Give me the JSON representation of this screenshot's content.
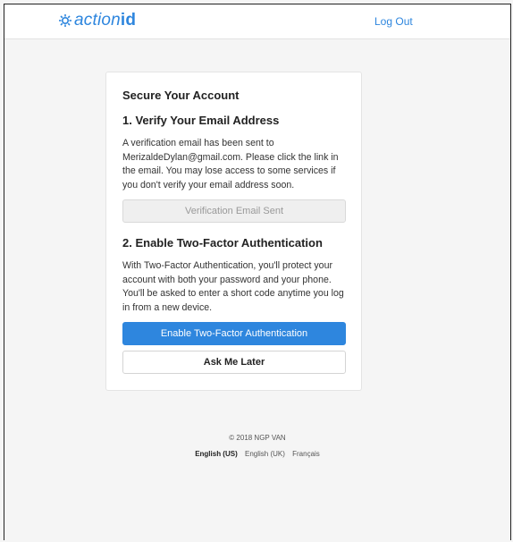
{
  "header": {
    "logo_part1": "action",
    "logo_part2": "id",
    "logout_label": "Log Out"
  },
  "card": {
    "title": "Secure Your Account",
    "section1": {
      "title": "1. Verify Your Email Address",
      "text": "A verification email has been sent to MerizaldeDylan@gmail.com. Please click the link in the email. You may lose access to some services if you don't verify your email address soon.",
      "button_label": "Verification Email Sent"
    },
    "section2": {
      "title": "2. Enable Two-Factor Authentication",
      "text": "With Two-Factor Authentication, you'll protect your account with both your password and your phone. You'll be asked to enter a short code anytime you log in from a new device.",
      "primary_button_label": "Enable Two-Factor Authentication",
      "secondary_button_label": "Ask Me Later"
    }
  },
  "footer": {
    "copyright": "© 2018 NGP VAN",
    "languages": [
      "English (US)",
      "English (UK)",
      "Français"
    ]
  },
  "colors": {
    "accent": "#2e86de",
    "disabled_button_bg": "#efefef",
    "page_bg": "#f5f5f5"
  },
  "icons": {
    "logo": "gear-icon"
  }
}
